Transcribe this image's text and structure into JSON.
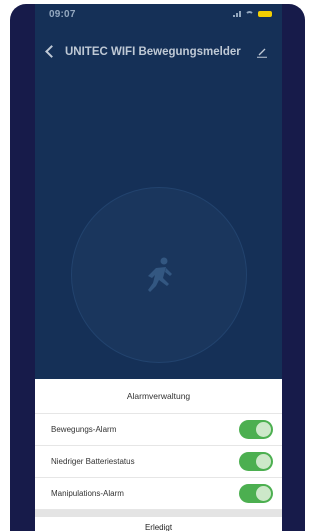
{
  "status_bar": {
    "time": "09:07 ",
    "battery_color": "#ffd900",
    "icons": [
      "signal-icon",
      "wifi-icon",
      "battery-icon"
    ]
  },
  "nav": {
    "title": "UNITEC WIFI Bewegungsmelder",
    "back_icon": "back-icon",
    "edit_icon": "edit-icon"
  },
  "device": {
    "icon": "running-person-icon"
  },
  "sheet": {
    "title": "Alarmverwaltung",
    "rows": [
      {
        "label": "Bewegungs-Alarm",
        "enabled": true
      },
      {
        "label": "Niedriger Batteriestatus",
        "enabled": true
      },
      {
        "label": "Manipulations-Alarm",
        "enabled": true
      }
    ],
    "done_label": "Erledigt"
  },
  "colors": {
    "background": "#16325a",
    "frame": "#171b4a",
    "toggle_on": "#4caf50"
  }
}
